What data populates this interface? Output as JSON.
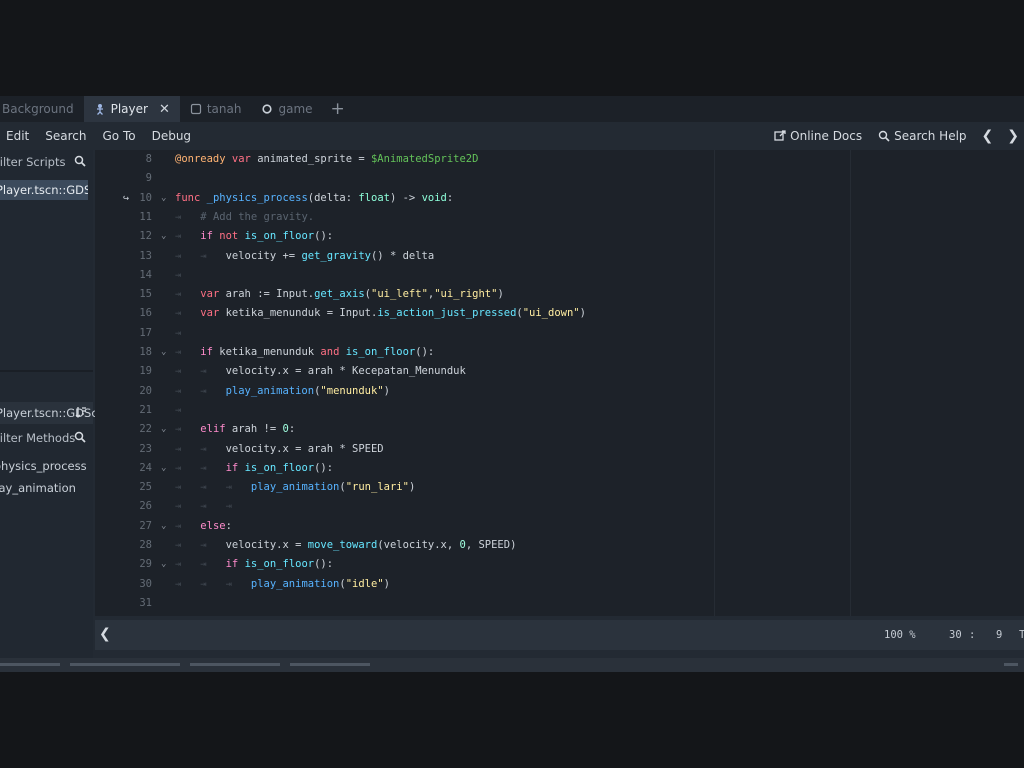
{
  "scene_tabs": [
    {
      "label": "Background",
      "icon": "scene-icon",
      "active": false
    },
    {
      "label": "Player",
      "icon": "character-icon",
      "active": true
    },
    {
      "label": "tanah",
      "icon": "tilemap-icon",
      "active": false
    },
    {
      "label": "game",
      "icon": "node-icon",
      "active": false
    }
  ],
  "menu": [
    "Edit",
    "Search",
    "Go To",
    "Debug"
  ],
  "help": {
    "online_docs": "Online Docs",
    "search_help": "Search Help"
  },
  "left_panel": {
    "scripts_header": "Filter Scripts",
    "open_script": "Player.tscn::GDScript",
    "class_name": "Player.tscn::GDScript",
    "methods_header": "Filter Methods",
    "methods": [
      "_physics_process",
      "play_animation"
    ]
  },
  "code": {
    "lines": [
      {
        "n": "8",
        "fold": "",
        "parts": [
          [
            "ann",
            "@onready"
          ],
          [
            "p",
            " "
          ],
          [
            "kw",
            "var"
          ],
          [
            "p",
            " animated_sprite = "
          ],
          [
            "node",
            "$AnimatedSprite2D"
          ]
        ]
      },
      {
        "n": "9",
        "fold": "",
        "parts": []
      },
      {
        "n": "10",
        "fold": "⌄",
        "bookmark": true,
        "parts": [
          [
            "kw",
            "func"
          ],
          [
            "p",
            " "
          ],
          [
            "fn",
            "_physics_process"
          ],
          [
            "p",
            "(delta: "
          ],
          [
            "type",
            "float"
          ],
          [
            "p",
            ") -> "
          ],
          [
            "type",
            "void"
          ],
          [
            "p",
            ":"
          ]
        ]
      },
      {
        "n": "11",
        "fold": "",
        "parts": [
          [
            "tab",
            "⇥"
          ],
          [
            "p",
            "   "
          ],
          [
            "cm",
            "# Add the gravity."
          ]
        ]
      },
      {
        "n": "12",
        "fold": "⌄",
        "parts": [
          [
            "tab",
            "⇥"
          ],
          [
            "p",
            "   "
          ],
          [
            "key",
            "if"
          ],
          [
            "p",
            " "
          ],
          [
            "kw",
            "not"
          ],
          [
            "p",
            " "
          ],
          [
            "fnc",
            "is_on_floor"
          ],
          [
            "p",
            "():"
          ]
        ]
      },
      {
        "n": "13",
        "fold": "",
        "parts": [
          [
            "tab",
            "⇥   ⇥"
          ],
          [
            "p",
            "   velocity += "
          ],
          [
            "fnc",
            "get_gravity"
          ],
          [
            "p",
            "() * delta"
          ]
        ]
      },
      {
        "n": "14",
        "fold": "",
        "parts": [
          [
            "tab",
            "⇥"
          ]
        ]
      },
      {
        "n": "15",
        "fold": "",
        "parts": [
          [
            "tab",
            "⇥"
          ],
          [
            "p",
            "   "
          ],
          [
            "kw",
            "var"
          ],
          [
            "p",
            " arah := Input."
          ],
          [
            "fnc",
            "get_axis"
          ],
          [
            "p",
            "("
          ],
          [
            "str",
            "\"ui_left\""
          ],
          [
            "p",
            ","
          ],
          [
            "str",
            "\"ui_right\""
          ],
          [
            "p",
            ")"
          ]
        ]
      },
      {
        "n": "16",
        "fold": "",
        "parts": [
          [
            "tab",
            "⇥"
          ],
          [
            "p",
            "   "
          ],
          [
            "kw",
            "var"
          ],
          [
            "p",
            " ketika_menunduk = Input."
          ],
          [
            "fnc",
            "is_action_just_pressed"
          ],
          [
            "p",
            "("
          ],
          [
            "str",
            "\"ui_down\""
          ],
          [
            "p",
            ")"
          ]
        ]
      },
      {
        "n": "17",
        "fold": "",
        "parts": [
          [
            "tab",
            "⇥"
          ]
        ]
      },
      {
        "n": "18",
        "fold": "⌄",
        "parts": [
          [
            "tab",
            "⇥"
          ],
          [
            "p",
            "   "
          ],
          [
            "key",
            "if"
          ],
          [
            "p",
            " ketika_menunduk "
          ],
          [
            "kw",
            "and"
          ],
          [
            "p",
            " "
          ],
          [
            "fnc",
            "is_on_floor"
          ],
          [
            "p",
            "():"
          ]
        ]
      },
      {
        "n": "19",
        "fold": "",
        "parts": [
          [
            "tab",
            "⇥   ⇥"
          ],
          [
            "p",
            "   velocity.x = arah * Kecepatan_Menunduk"
          ]
        ]
      },
      {
        "n": "20",
        "fold": "",
        "parts": [
          [
            "tab",
            "⇥   ⇥"
          ],
          [
            "p",
            "   "
          ],
          [
            "fn",
            "play_animation"
          ],
          [
            "p",
            "("
          ],
          [
            "str",
            "\"menunduk\""
          ],
          [
            "p",
            ")"
          ]
        ]
      },
      {
        "n": "21",
        "fold": "",
        "parts": [
          [
            "tab",
            "⇥"
          ]
        ]
      },
      {
        "n": "22",
        "fold": "⌄",
        "parts": [
          [
            "tab",
            "⇥"
          ],
          [
            "p",
            "   "
          ],
          [
            "key",
            "elif"
          ],
          [
            "p",
            " arah != "
          ],
          [
            "num",
            "0"
          ],
          [
            "p",
            ":"
          ]
        ]
      },
      {
        "n": "23",
        "fold": "",
        "parts": [
          [
            "tab",
            "⇥   ⇥"
          ],
          [
            "p",
            "   velocity.x = arah * SPEED"
          ]
        ]
      },
      {
        "n": "24",
        "fold": "⌄",
        "parts": [
          [
            "tab",
            "⇥   ⇥"
          ],
          [
            "p",
            "   "
          ],
          [
            "key",
            "if"
          ],
          [
            "p",
            " "
          ],
          [
            "fnc",
            "is_on_floor"
          ],
          [
            "p",
            "():"
          ]
        ]
      },
      {
        "n": "25",
        "fold": "",
        "parts": [
          [
            "tab",
            "⇥   ⇥   ⇥"
          ],
          [
            "p",
            "   "
          ],
          [
            "fn",
            "play_animation"
          ],
          [
            "p",
            "("
          ],
          [
            "str",
            "\"run_lari\""
          ],
          [
            "p",
            ")"
          ]
        ]
      },
      {
        "n": "26",
        "fold": "",
        "parts": [
          [
            "tab",
            "⇥   ⇥   ⇥"
          ]
        ]
      },
      {
        "n": "27",
        "fold": "⌄",
        "parts": [
          [
            "tab",
            "⇥"
          ],
          [
            "p",
            "   "
          ],
          [
            "key",
            "else"
          ],
          [
            "p",
            ":"
          ]
        ]
      },
      {
        "n": "28",
        "fold": "",
        "parts": [
          [
            "tab",
            "⇥   ⇥"
          ],
          [
            "p",
            "   velocity.x = "
          ],
          [
            "fnc",
            "move_toward"
          ],
          [
            "p",
            "(velocity.x, "
          ],
          [
            "num",
            "0"
          ],
          [
            "p",
            ", SPEED)"
          ]
        ]
      },
      {
        "n": "29",
        "fold": "⌄",
        "parts": [
          [
            "tab",
            "⇥   ⇥"
          ],
          [
            "p",
            "   "
          ],
          [
            "key",
            "if"
          ],
          [
            "p",
            " "
          ],
          [
            "fnc",
            "is_on_floor"
          ],
          [
            "p",
            "():"
          ]
        ]
      },
      {
        "n": "30",
        "fold": "",
        "parts": [
          [
            "tab",
            "⇥   ⇥   ⇥"
          ],
          [
            "p",
            "   "
          ],
          [
            "fn",
            "play_animation"
          ],
          [
            "p",
            "("
          ],
          [
            "str",
            "\"idle\""
          ],
          [
            "p",
            ")"
          ]
        ]
      },
      {
        "n": "31",
        "fold": "",
        "parts": []
      }
    ]
  },
  "status": {
    "zoom": "100 %",
    "line": "30",
    "column": "9",
    "indent_type": "T"
  },
  "colors": {
    "background": "#1d2229",
    "accent": "#57b3ff"
  }
}
